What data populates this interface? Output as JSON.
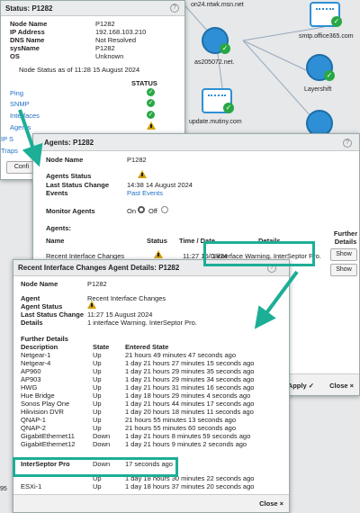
{
  "background": {
    "nodes": [
      {
        "label": "on24.ntwk.msn.net"
      },
      {
        "label": "smtp.office365.com"
      },
      {
        "label": "as205072.net."
      },
      {
        "label": "Layershift"
      },
      {
        "label": "update.mutiny.com"
      }
    ],
    "left_clip": "95"
  },
  "status_dialog": {
    "title": "Status: P1282",
    "rows": [
      {
        "label": "Node Name",
        "value": "P1282"
      },
      {
        "label": "IP Address",
        "value": "192.168.103.210"
      },
      {
        "label": "DNS Name",
        "value": "Not Resolved"
      },
      {
        "label": "sysName",
        "value": "P1282"
      },
      {
        "label": "OS",
        "value": "Unknown"
      }
    ],
    "status_as_of": "Node Status as of 11:28 15 August 2024",
    "status_header": "STATUS",
    "checks": [
      {
        "name": "Ping",
        "status": "ok"
      },
      {
        "name": "SNMP",
        "status": "ok"
      },
      {
        "name": "Interfaces",
        "status": "ok"
      },
      {
        "name": "Agents",
        "status": "warn"
      },
      {
        "name": "IP S",
        "status": "ok"
      },
      {
        "name": "Traps",
        "status": "ok"
      }
    ],
    "config_button": "Confi"
  },
  "agents_dialog": {
    "title": "Agents: P1282",
    "node_name_label": "Node Name",
    "node_name_value": "P1282",
    "agents_status_label": "Agents Status",
    "last_status_change_label": "Last Status Change",
    "last_status_change_value": "14:38 14 August 2024",
    "events_label": "Events",
    "events_link": "Past Events",
    "monitor_label": "Monitor Agents",
    "monitor_on": "On",
    "monitor_off": "Off",
    "agents_heading": "Agents:",
    "columns": {
      "name": "Name",
      "status": "Status",
      "time": "Time / Date",
      "details": "Details",
      "further": "Further Details"
    },
    "row": {
      "name": "Recent Interface Changes",
      "time": "11:27 15/08/24",
      "details": "1 interface Warning. InterSeptor Pro."
    },
    "show_label": "Show",
    "apply_label": "Apply ✓",
    "close_label": "Close ×"
  },
  "changes_dialog": {
    "title": "Recent Interface Changes Agent Details: P1282",
    "node_name_label": "Node Name",
    "node_name_value": "P1282",
    "agent_label": "Agent",
    "agent_value": "Recent Interface Changes",
    "agent_status_label": "Agent Status",
    "last_status_change_label": "Last Status Change",
    "last_status_change_value": "11:27 15 August 2024",
    "details_label": "Details",
    "details_value": "1 interface Warning. InterSeptor Pro.",
    "further_heading": "Further Details",
    "columns": {
      "description": "Description",
      "state": "State",
      "entered": "Entered State"
    },
    "rows": [
      {
        "description": "Netgear-1",
        "state": "Up",
        "entered": "21 hours 49 minutes 47 seconds ago"
      },
      {
        "description": "Netgear-4",
        "state": "Up",
        "entered": "1 day 21 hours 27 minutes 15 seconds ago"
      },
      {
        "description": "AP960",
        "state": "Up",
        "entered": "1 day 21 hours 29 minutes 35 seconds ago"
      },
      {
        "description": "AP903",
        "state": "Up",
        "entered": "1 day 21 hours 29 minutes 34 seconds ago"
      },
      {
        "description": "HWG",
        "state": "Up",
        "entered": "1 day 21 hours 31 minutes 16 seconds ago"
      },
      {
        "description": "Hue Bridge",
        "state": "Up",
        "entered": "1 day 18 hours 29 minutes 4 seconds ago"
      },
      {
        "description": "Sonos Play One",
        "state": "Up",
        "entered": "1 day 21 hours 44 minutes 17 seconds ago"
      },
      {
        "description": "Hikvision DVR",
        "state": "Up",
        "entered": "1 day 20 hours 18 minutes 11 seconds ago"
      },
      {
        "description": "QNAP-1",
        "state": "Up",
        "entered": "21 hours 55 minutes 13 seconds ago"
      },
      {
        "description": "QNAP-2",
        "state": "Up",
        "entered": "21 hours 55 minutes 60 seconds ago"
      },
      {
        "description": "GigabitEthernet11",
        "state": "Down",
        "entered": "1 day 21 hours 8 minutes 59 seconds ago"
      },
      {
        "description": "GigabitEthernet12",
        "state": "Down",
        "entered": "1 day 21 hours 9 minutes 2 seconds ago"
      },
      {
        "description": "InterSeptor Pro",
        "state": "Down",
        "entered": "17 seconds ago"
      },
      {
        "description": "",
        "state": "Up",
        "entered": "1 day 18 hours 30 minutes 22 seconds ago"
      },
      {
        "description": "ESXi-1",
        "state": "Up",
        "entered": "1 day 18 hours 37 minutes 20 seconds ago"
      }
    ],
    "close_label": "Close ×"
  },
  "colors": {
    "accent": "#1cae96",
    "ok": "#27a844",
    "warn": "#d4a100",
    "link": "#1f6fc5"
  }
}
